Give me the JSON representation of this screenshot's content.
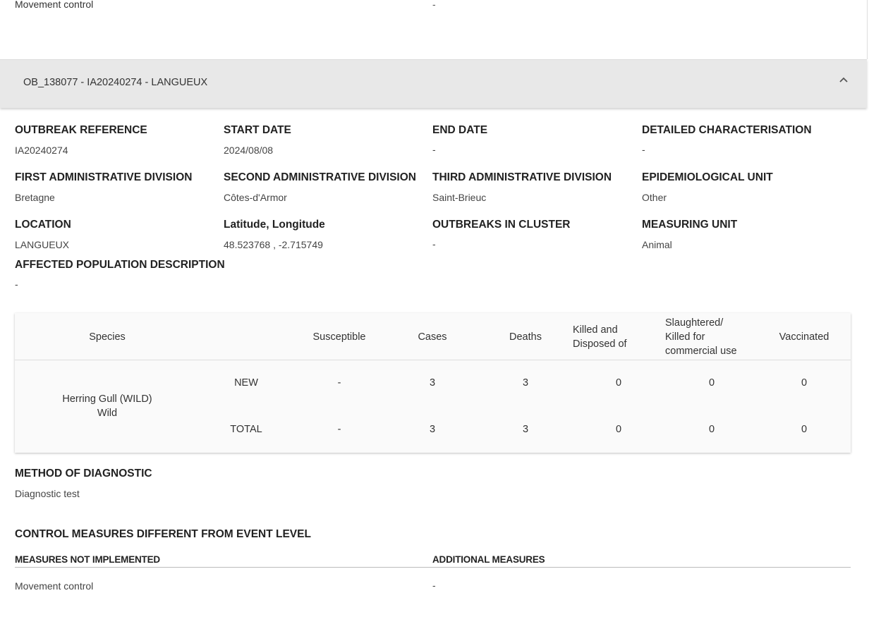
{
  "prev_section": {
    "label": "Movement control",
    "value": "-"
  },
  "accordion": {
    "title": "OB_138077 - IA20240274 - LANGUEUX",
    "chevron_icon": "chevron-up-icon"
  },
  "fields": {
    "outbreak_reference": {
      "label": "OUTBREAK REFERENCE",
      "value": "IA20240274"
    },
    "start_date": {
      "label": "START DATE",
      "value": "2024/08/08"
    },
    "end_date": {
      "label": "END DATE",
      "value": "-"
    },
    "detailed_characterisation": {
      "label": "DETAILED CHARACTERISATION",
      "value": "-"
    },
    "first_admin": {
      "label": "FIRST ADMINISTRATIVE DIVISION",
      "value": "Bretagne"
    },
    "second_admin": {
      "label": "SECOND ADMINISTRATIVE DIVISION",
      "value": "Côtes-d'Armor"
    },
    "third_admin": {
      "label": "THIRD ADMINISTRATIVE DIVISION",
      "value": "Saint-Brieuc"
    },
    "epi_unit": {
      "label": "EPIDEMIOLOGICAL UNIT",
      "value": "Other"
    },
    "location": {
      "label": "LOCATION",
      "value": "LANGUEUX"
    },
    "latlon": {
      "label": "Latitude, Longitude",
      "value": "48.523768 , -2.715749"
    },
    "outbreaks_cluster": {
      "label": "OUTBREAKS IN CLUSTER",
      "value": "-"
    },
    "measuring_unit": {
      "label": "MEASURING UNIT",
      "value": "Animal"
    },
    "affected_population": {
      "label": "AFFECTED POPULATION DESCRIPTION",
      "value": "-"
    }
  },
  "table": {
    "headers": {
      "species": "Species",
      "susceptible": "Susceptible",
      "cases": "Cases",
      "deaths": "Deaths",
      "killed_1": "Killed and",
      "killed_2": "Disposed of",
      "slaughtered_1": "Slaughtered/",
      "slaughtered_2": "Killed for",
      "slaughtered_3": "commercial use",
      "vaccinated": "Vaccinated"
    },
    "species_name": "Herring Gull (WILD)",
    "species_type": "Wild",
    "rows": [
      {
        "label": "NEW",
        "susceptible": "-",
        "cases": "3",
        "deaths": "3",
        "killed": "0",
        "slaughtered": "0",
        "vaccinated": "0"
      },
      {
        "label": "TOTAL",
        "susceptible": "-",
        "cases": "3",
        "deaths": "3",
        "killed": "0",
        "slaughtered": "0",
        "vaccinated": "0"
      }
    ]
  },
  "diagnostic": {
    "label": "METHOD OF DIAGNOSTIC",
    "value": "Diagnostic test"
  },
  "control": {
    "title": "CONTROL MEASURES DIFFERENT FROM EVENT LEVEL",
    "not_implemented_label": "MEASURES NOT IMPLEMENTED",
    "additional_label": "ADDITIONAL MEASURES",
    "not_implemented_value": "Movement control",
    "additional_value": "-"
  }
}
